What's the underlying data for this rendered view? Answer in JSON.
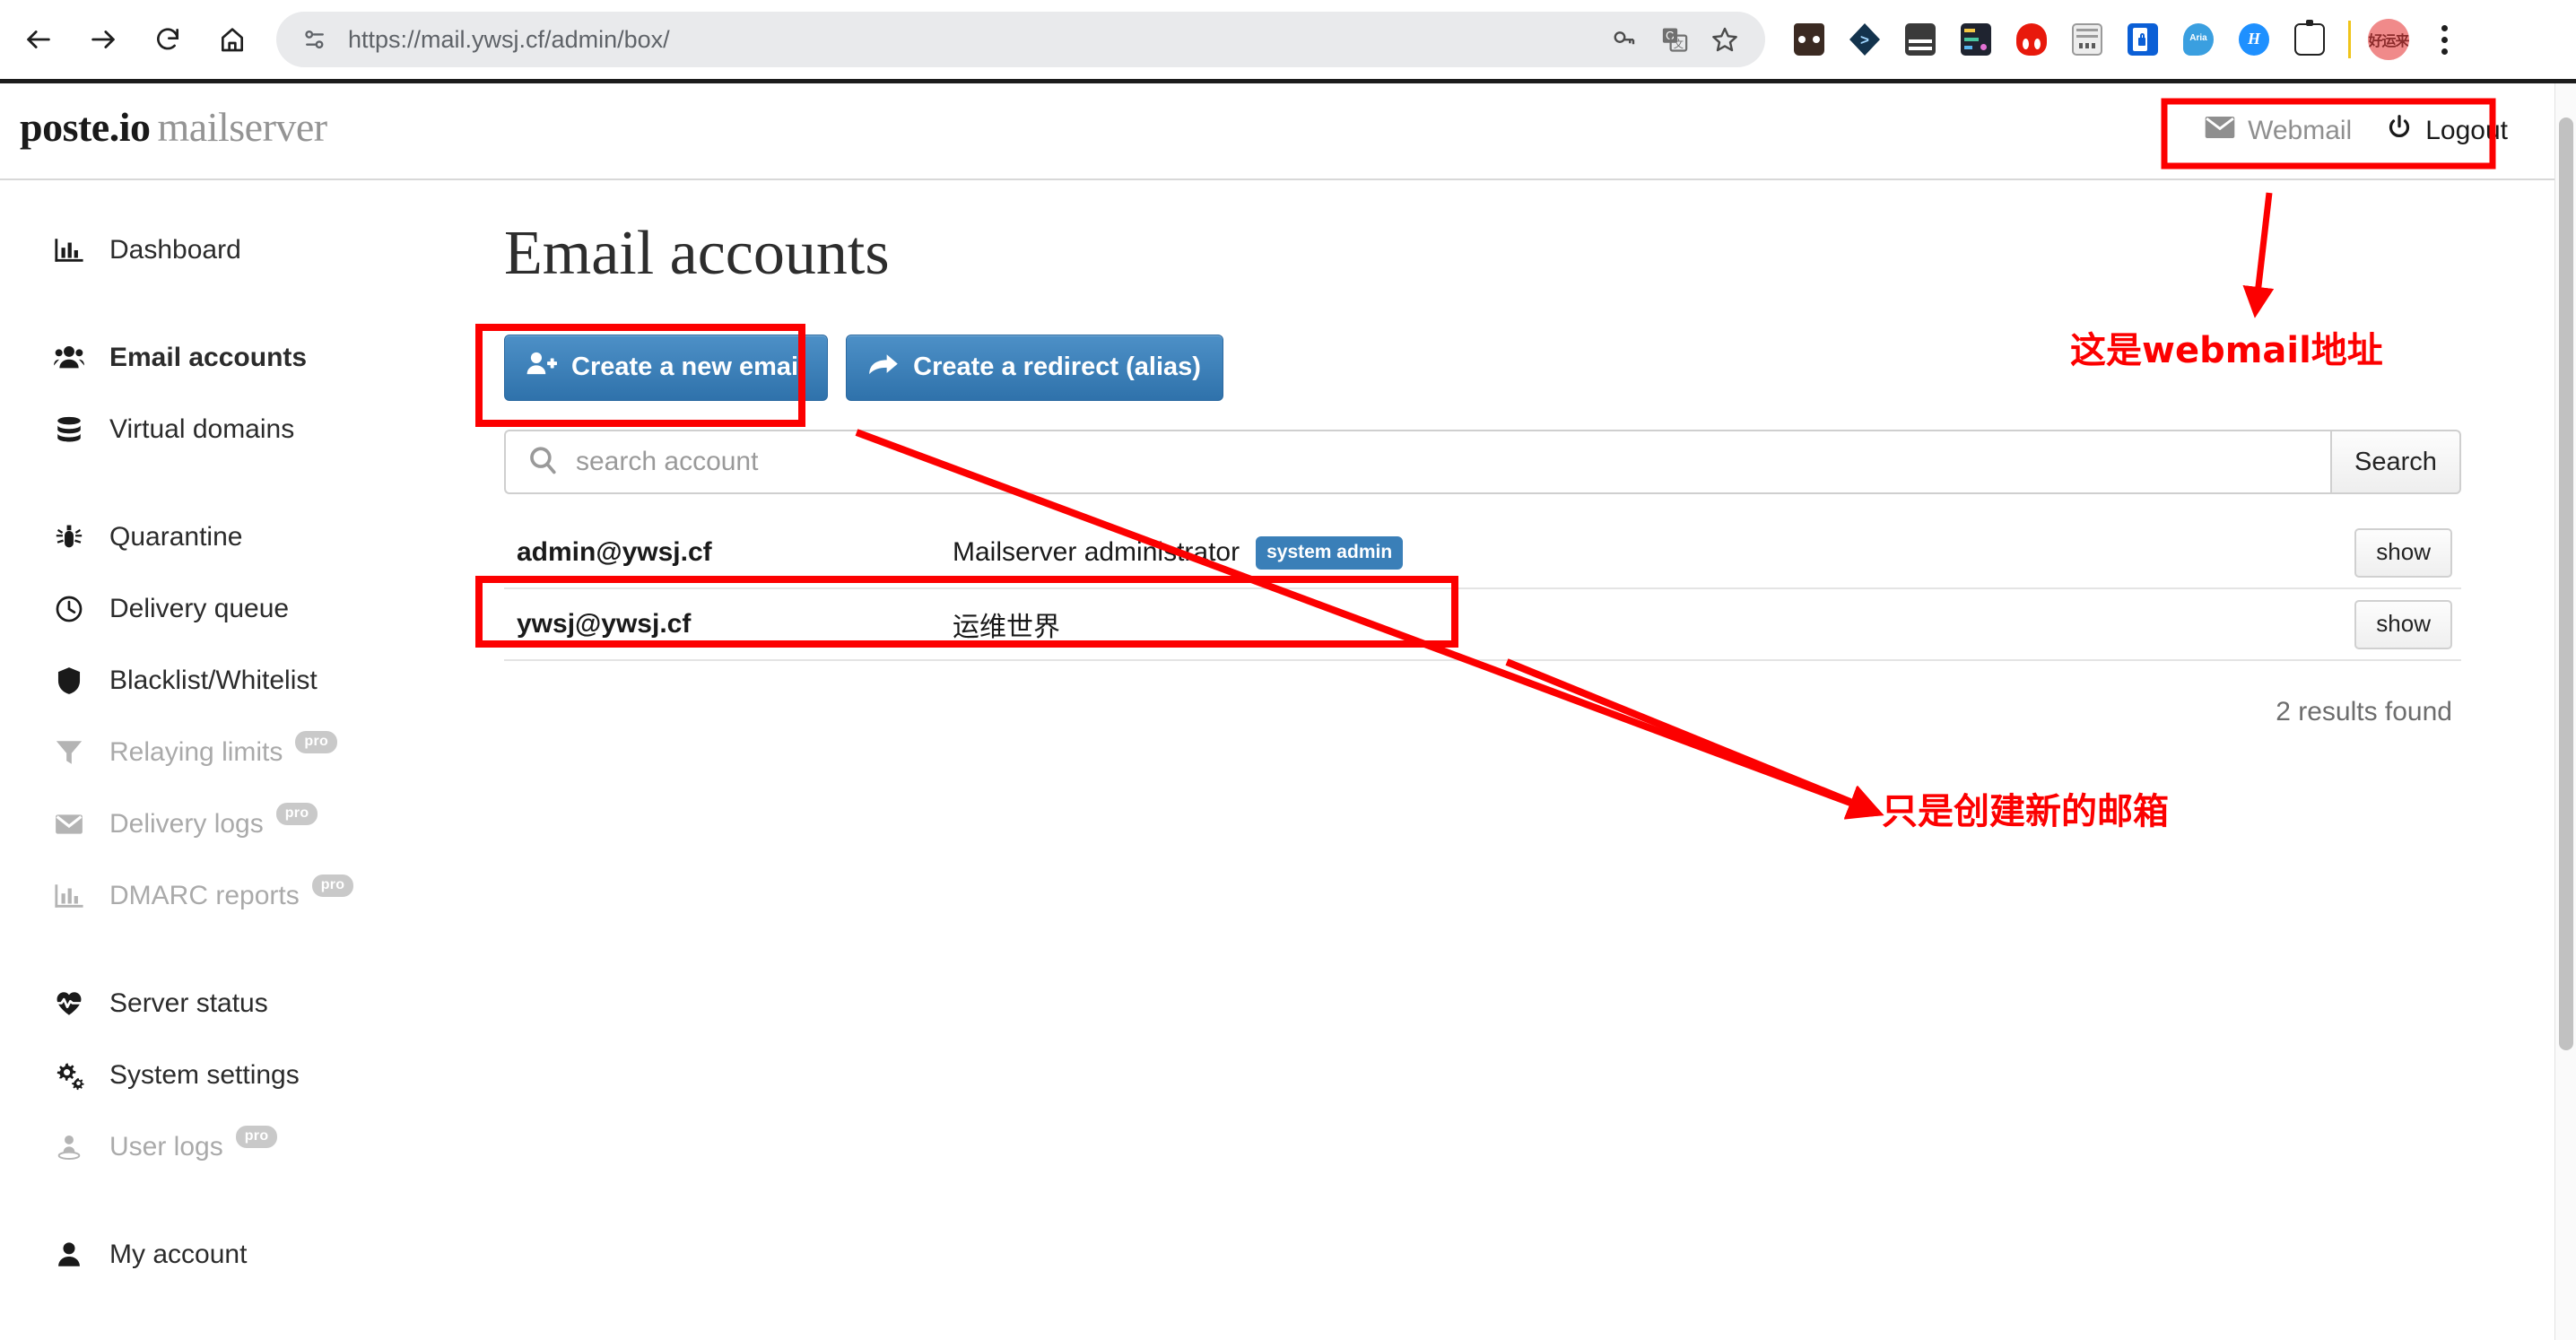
{
  "browser": {
    "url": "https://mail.ywsj.cf/admin/box/",
    "nav": {
      "back": "back-arrow",
      "forward": "forward-arrow",
      "reload": "reload",
      "home": "home"
    },
    "omnibox_icons": [
      "passkey-icon",
      "translate-icon",
      "bookmark-star-icon"
    ],
    "extensions": [
      {
        "name": "extension-bitwarden",
        "color": "#3b2a22"
      },
      {
        "name": "extension-dark-reader",
        "color": "#13334d"
      },
      {
        "name": "extension-keyboard",
        "color": "#3a3a3a"
      },
      {
        "name": "extension-notion",
        "color": "#1f2430"
      },
      {
        "name": "extension-moon-reader",
        "color": "#e8190c"
      },
      {
        "name": "extension-screen-ruler",
        "color": "#9a9a9a"
      },
      {
        "name": "extension-lastpass",
        "color": "#0b5fd6"
      },
      {
        "name": "extension-aria2",
        "color": "#3a9fe0"
      },
      {
        "name": "extension-grammarly",
        "color": "#1e90ff"
      },
      {
        "name": "extension-bottle",
        "color": "#222222"
      }
    ],
    "menu": "chrome-menu"
  },
  "app": {
    "brand_main": "poste.io",
    "brand_sub": "mailserver",
    "webmail_label": "Webmail",
    "logout_label": "Logout"
  },
  "sidebar": {
    "items": [
      {
        "label": "Dashboard",
        "icon": "chart-bar-icon",
        "active": false,
        "disabled": false,
        "badge": "",
        "gap_after": true
      },
      {
        "label": "Email accounts",
        "icon": "users-icon",
        "active": true,
        "disabled": false,
        "badge": "",
        "gap_after": false
      },
      {
        "label": "Virtual domains",
        "icon": "database-icon",
        "active": false,
        "disabled": false,
        "badge": "",
        "gap_after": true
      },
      {
        "label": "Quarantine",
        "icon": "bug-icon",
        "active": false,
        "disabled": false,
        "badge": "",
        "gap_after": false
      },
      {
        "label": "Delivery queue",
        "icon": "clock-icon",
        "active": false,
        "disabled": false,
        "badge": "",
        "gap_after": false
      },
      {
        "label": "Blacklist/Whitelist",
        "icon": "shield-icon",
        "active": false,
        "disabled": false,
        "badge": "",
        "gap_after": false
      },
      {
        "label": "Relaying limits",
        "icon": "filter-icon",
        "active": false,
        "disabled": true,
        "badge": "pro",
        "gap_after": false
      },
      {
        "label": "Delivery logs",
        "icon": "envelope-icon",
        "active": false,
        "disabled": true,
        "badge": "pro",
        "gap_after": false
      },
      {
        "label": "DMARC reports",
        "icon": "chart-bar-icon",
        "active": false,
        "disabled": true,
        "badge": "pro",
        "gap_after": true
      },
      {
        "label": "Server status",
        "icon": "heartbeat-icon",
        "active": false,
        "disabled": false,
        "badge": "",
        "gap_after": false
      },
      {
        "label": "System settings",
        "icon": "gears-icon",
        "active": false,
        "disabled": false,
        "badge": "",
        "gap_after": false
      },
      {
        "label": "User logs",
        "icon": "user-circle-icon",
        "active": false,
        "disabled": true,
        "badge": "pro",
        "gap_after": true
      },
      {
        "label": "My account",
        "icon": "user-icon",
        "active": false,
        "disabled": false,
        "badge": "",
        "gap_after": false
      }
    ]
  },
  "main": {
    "title": "Email accounts",
    "buttons": [
      {
        "label": "Create a new email",
        "icon": "user-plus-icon"
      },
      {
        "label": "Create a redirect (alias)",
        "icon": "share-arrow-icon"
      }
    ],
    "search": {
      "placeholder": "search account",
      "icon": "search-icon",
      "button_label": "Search"
    },
    "accounts": [
      {
        "email": "admin@ywsj.cf",
        "name": "Mailserver administrator",
        "badge": "system admin",
        "action": "show"
      },
      {
        "email": "ywsj@ywsj.cf",
        "name": "运维世界",
        "badge": "",
        "action": "show"
      }
    ],
    "results_text": "2 results found"
  },
  "annotations": {
    "accent_color": "#fc0000",
    "texts": [
      {
        "id": "webmail-note",
        "text": "这是webmail地址"
      },
      {
        "id": "create-email-note",
        "text": "只是创建新的邮箱"
      }
    ],
    "boxes": [
      "webmail-box",
      "create-email-button-box",
      "ywsj-row-box"
    ],
    "arrows": [
      "webmail-arrow",
      "create-button-arrow",
      "ywsj-row-arrow"
    ]
  }
}
